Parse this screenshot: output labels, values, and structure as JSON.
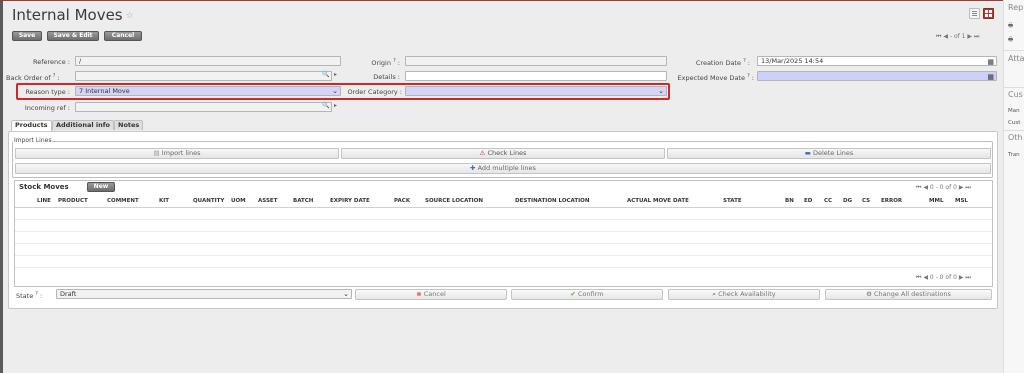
{
  "header": {
    "title": "Internal Moves",
    "star": "☆",
    "save_label": "Save",
    "save_edit_label": "Save & Edit",
    "cancel_label": "Cancel",
    "pager_text": "- of 1"
  },
  "form": {
    "reference_label": "Reference :",
    "reference_value": "/",
    "back_order_label": "Back Order of",
    "reason_type_label": "Reason type :",
    "reason_type_value": "7 Internal Move",
    "incoming_ref_label": "Incoming ref :",
    "origin_label": "Origin",
    "details_label": "Details :",
    "order_category_label": "Order Category :",
    "order_category_value": "",
    "creation_date_label": "Creation Date",
    "creation_date_value": "13/Mar/2025 14:54",
    "expected_move_date_label": "Expected Move Date",
    "help_mark": "?",
    "colon": ":"
  },
  "tabs": [
    {
      "label": "Products"
    },
    {
      "label": "Additional info"
    },
    {
      "label": "Notes"
    }
  ],
  "import_lines": {
    "legend": "Import Lines",
    "import_label": "Import lines",
    "check_label": "Check Lines",
    "delete_label": "Delete Lines",
    "add_multiple_label": "Add multiple lines"
  },
  "stock_moves": {
    "title": "Stock Moves",
    "new_label": "New",
    "pager_text": "0 - 0 of 0",
    "columns": [
      "LINE",
      "PRODUCT",
      "COMMENT",
      "KIT",
      "QUANTITY",
      "UOM",
      "ASSET",
      "BATCH",
      "EXPIRY DATE",
      "PACK",
      "SOURCE LOCATION",
      "DESTINATION LOCATION",
      "ACTUAL MOVE DATE",
      "STATE",
      "BN",
      "ED",
      "CC",
      "DG",
      "CS",
      "ERROR",
      "MML",
      "MSL"
    ]
  },
  "footer": {
    "state_label": "State",
    "state_value": "Draft",
    "cancel_label": "Cancel",
    "confirm_label": "Confirm",
    "check_availability_label": "Check Availability",
    "change_destinations_label": "Change All destinations"
  },
  "sidebar": {
    "reports_label": "Rep",
    "attachments_label": "Atta",
    "customize_label": "Cus",
    "customize_item1": "Man",
    "customize_item2": "Cust",
    "other_label": "Oth",
    "other_item1": "Tran"
  },
  "colors": {
    "accent": "#b53a2e",
    "highlight_border": "#d02828",
    "required_field": "#cfd0f7"
  }
}
